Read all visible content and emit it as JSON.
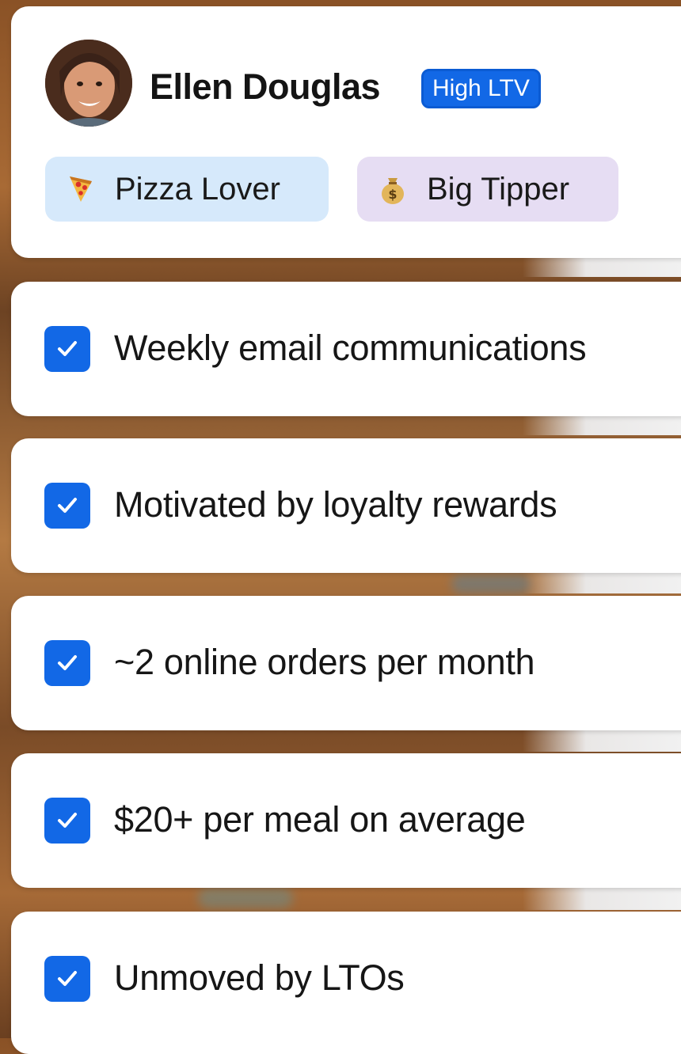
{
  "profile": {
    "name": "Ellen Douglas",
    "badge": "High LTV",
    "tags": [
      {
        "label": "Pizza Lover",
        "icon": "pizza-icon"
      },
      {
        "label": "Big Tipper",
        "icon": "money-bag-icon"
      }
    ]
  },
  "checklist": [
    {
      "label": "Weekly email communications",
      "checked": true
    },
    {
      "label": "Motivated by loyalty rewards",
      "checked": true
    },
    {
      "label": "~2 online orders per month",
      "checked": true
    },
    {
      "label": "$20+ per meal on average",
      "checked": true
    },
    {
      "label": "Unmoved by LTOs",
      "checked": true
    }
  ],
  "colors": {
    "accent": "#1268e6",
    "pizza_tag_bg": "#d6e9fb",
    "tipper_tag_bg": "#e6ddf3"
  }
}
